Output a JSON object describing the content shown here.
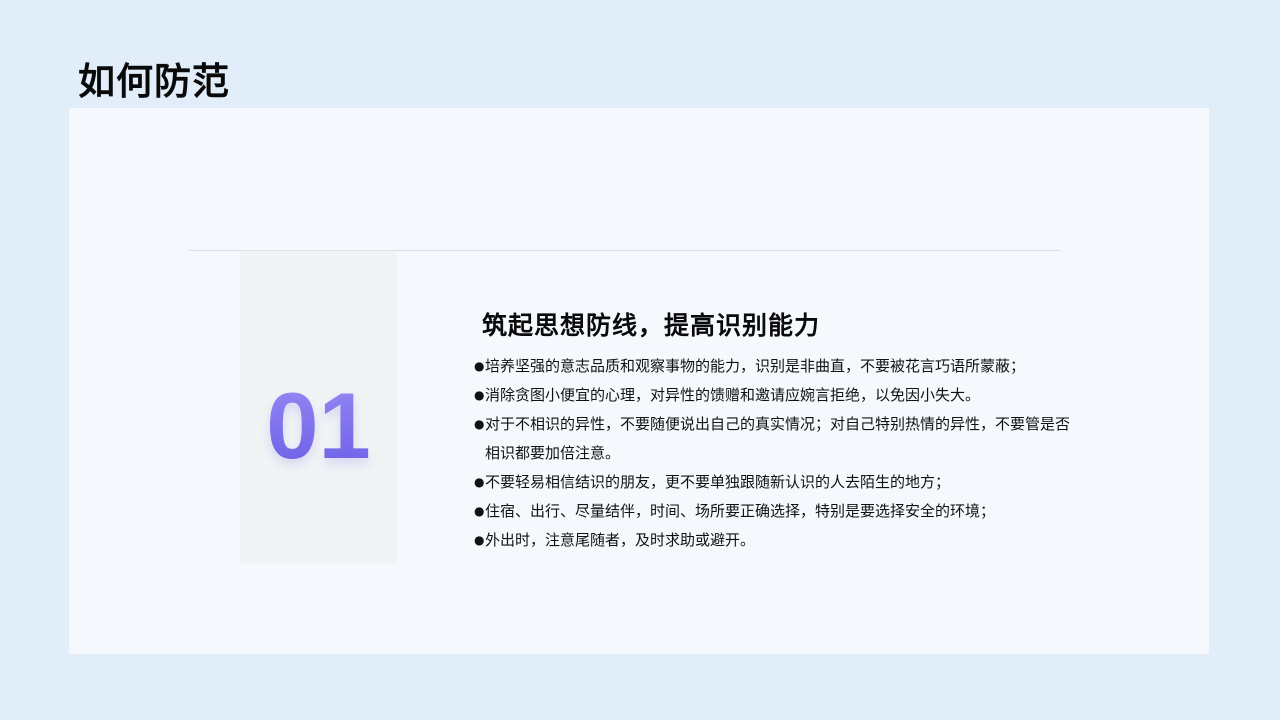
{
  "slide": {
    "title": "如何防范"
  },
  "section": {
    "number": "01",
    "heading": "筑起思想防线，提高识别能力",
    "bullet_symbol": "●",
    "bullets": [
      "培养坚强的意志品质和观察事物的能力，识别是非曲直，不要被花言巧语所蒙蔽；",
      "消除贪图小便宜的心理，对异性的馈赠和邀请应婉言拒绝，以免因小失大。",
      "对于不相识的异性，不要随便说出自己的真实情况；对自己特别热情的异性，不要管是否相识都要加倍注意。",
      "不要轻易相信结识的朋友，更不要单独跟随新认识的人去陌生的地方；",
      "住宿、出行、尽量结伴，时间、场所要正确选择，特别是要选择安全的环境；",
      "外出时，注意尾随者，及时求助或避开。"
    ]
  },
  "colors": {
    "background": "#e1eef9",
    "panel": "#f5f9fd",
    "number_block": "#f1f3f5",
    "accent_number": "#7a6ff0",
    "text": "#0a0a0a"
  }
}
